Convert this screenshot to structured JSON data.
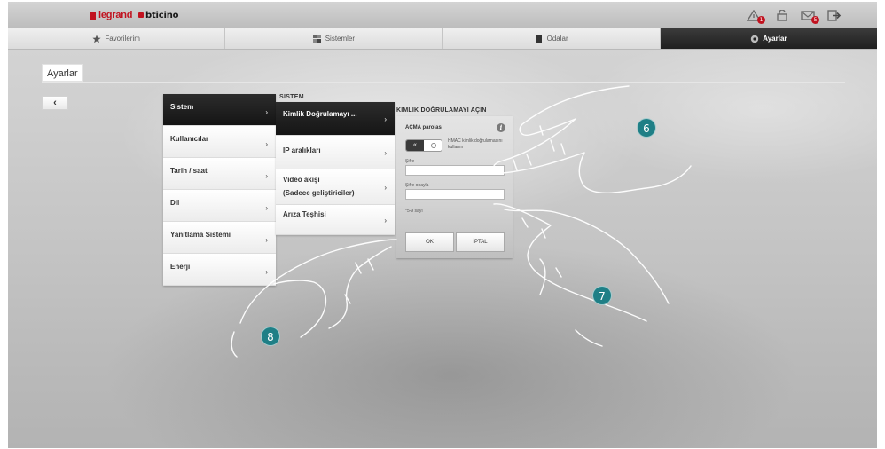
{
  "header": {
    "brand_legrand": "legrand",
    "brand_bticino": "bticino",
    "icons": [
      {
        "name": "alarm-warning-icon",
        "badge": "1"
      },
      {
        "name": "lock-icon",
        "badge": ""
      },
      {
        "name": "mail-icon",
        "badge": "5"
      },
      {
        "name": "logout-icon",
        "badge": ""
      }
    ],
    "badge_color": "#c1121f"
  },
  "tabs": [
    {
      "label": "Favorilerim",
      "icon": "star-icon",
      "active": false
    },
    {
      "label": "Sistemler",
      "icon": "grid-icon",
      "active": false
    },
    {
      "label": "Odalar",
      "icon": "door-icon",
      "active": false
    },
    {
      "label": "Ayarlar",
      "icon": "gear-icon",
      "active": true
    }
  ],
  "page": {
    "title": "Ayarlar",
    "back_label": "‹"
  },
  "menu": {
    "items": [
      {
        "label": "Sistem",
        "active": true
      },
      {
        "label": "Kullanıcılar",
        "active": false
      },
      {
        "label": "Tarih / saat",
        "active": false
      },
      {
        "label": "Dil",
        "active": false
      },
      {
        "label": "Yanıtlama Sistemi",
        "active": false
      },
      {
        "label": "Enerji",
        "active": false
      }
    ],
    "chevron": "›"
  },
  "submenu": {
    "title": "SISTEM",
    "items": [
      {
        "label": "Kimlik Doğrulamayı ...",
        "label2": "",
        "active": true
      },
      {
        "label": "IP aralıkları",
        "label2": "",
        "active": false
      },
      {
        "label": "Video akışı",
        "label2": "(Sadece geliştiriciler)",
        "active": false
      },
      {
        "label": "Arıza Teşhisi",
        "label2": "",
        "active": false
      }
    ]
  },
  "auth_panel": {
    "title": "KIMLIK DOĞRULAMAYI AÇIN",
    "password_label": "AÇMA parolası",
    "info_label": "i",
    "toggle_knob": "«",
    "hmac_label": "HMAC kimlik doğrulamasını kullanın",
    "field1_label": "Şifre",
    "field2_label": "Şifre onayla",
    "hint": "*5-9 sayı",
    "ok_label": "OK",
    "cancel_label": "İPTAL"
  },
  "steps": [
    "6",
    "7",
    "8"
  ],
  "accent_color": "#1f7f86"
}
